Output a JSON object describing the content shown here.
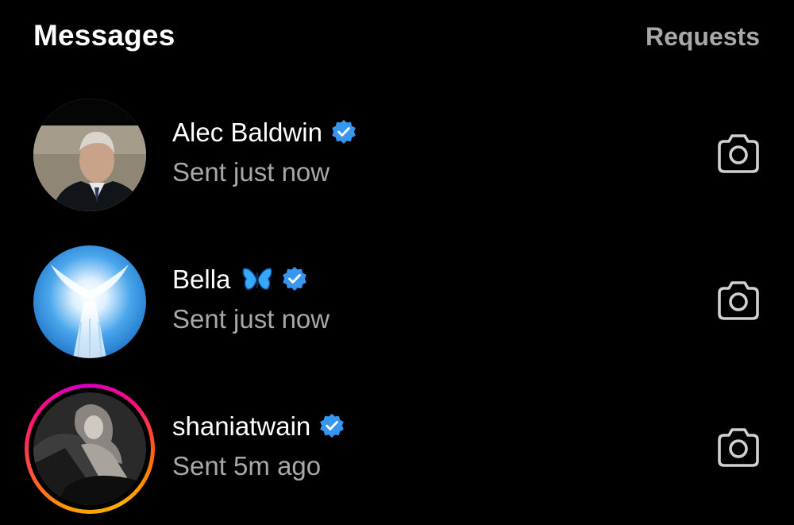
{
  "header": {
    "title": "Messages",
    "requests_label": "Requests"
  },
  "threads": [
    {
      "name": "Alec Baldwin",
      "emoji": "",
      "verified": true,
      "status": "Sent just now",
      "avatar_ring": false,
      "icon": "camera-icon"
    },
    {
      "name": "Bella",
      "emoji": "🦋",
      "verified": true,
      "status": "Sent just now",
      "avatar_ring": false,
      "icon": "camera-icon"
    },
    {
      "name": "shaniatwain",
      "emoji": "",
      "verified": true,
      "status": "Sent 5m ago",
      "avatar_ring": true,
      "icon": "camera-icon"
    }
  ],
  "colors": {
    "background": "#000000",
    "primary_text": "#ffffff",
    "secondary_text": "#a8a8a8",
    "verified_badge": "#3797f0"
  }
}
